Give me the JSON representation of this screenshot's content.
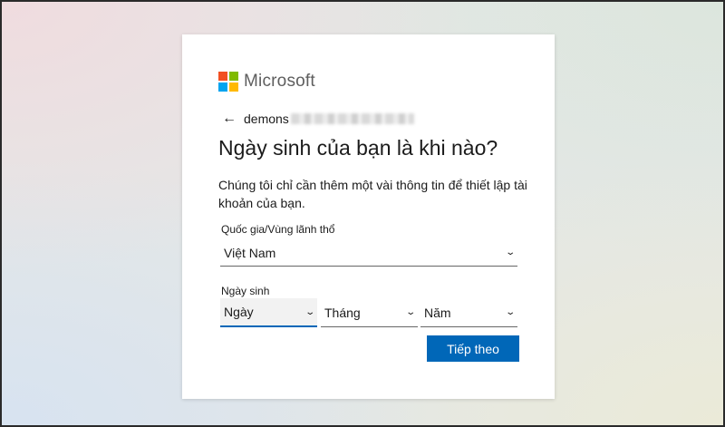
{
  "brand": {
    "name": "Microsoft",
    "logo_colors": [
      "#f25022",
      "#7fba00",
      "#00a4ef",
      "#ffb900"
    ]
  },
  "identity": {
    "back_icon": "arrow-left-icon",
    "email_visible": "demons"
  },
  "title": "Ngày sinh của bạn là khi nào?",
  "description": "Chúng tôi chỉ cần thêm một vài thông tin để thiết lập tài khoản của bạn.",
  "country": {
    "label": "Quốc gia/Vùng lãnh thổ",
    "value": "Việt Nam"
  },
  "birthdate": {
    "label": "Ngày sinh",
    "day": "Ngày",
    "month": "Tháng",
    "year": "Năm"
  },
  "next_button": "Tiếp theo",
  "colors": {
    "accent": "#0067b8"
  }
}
